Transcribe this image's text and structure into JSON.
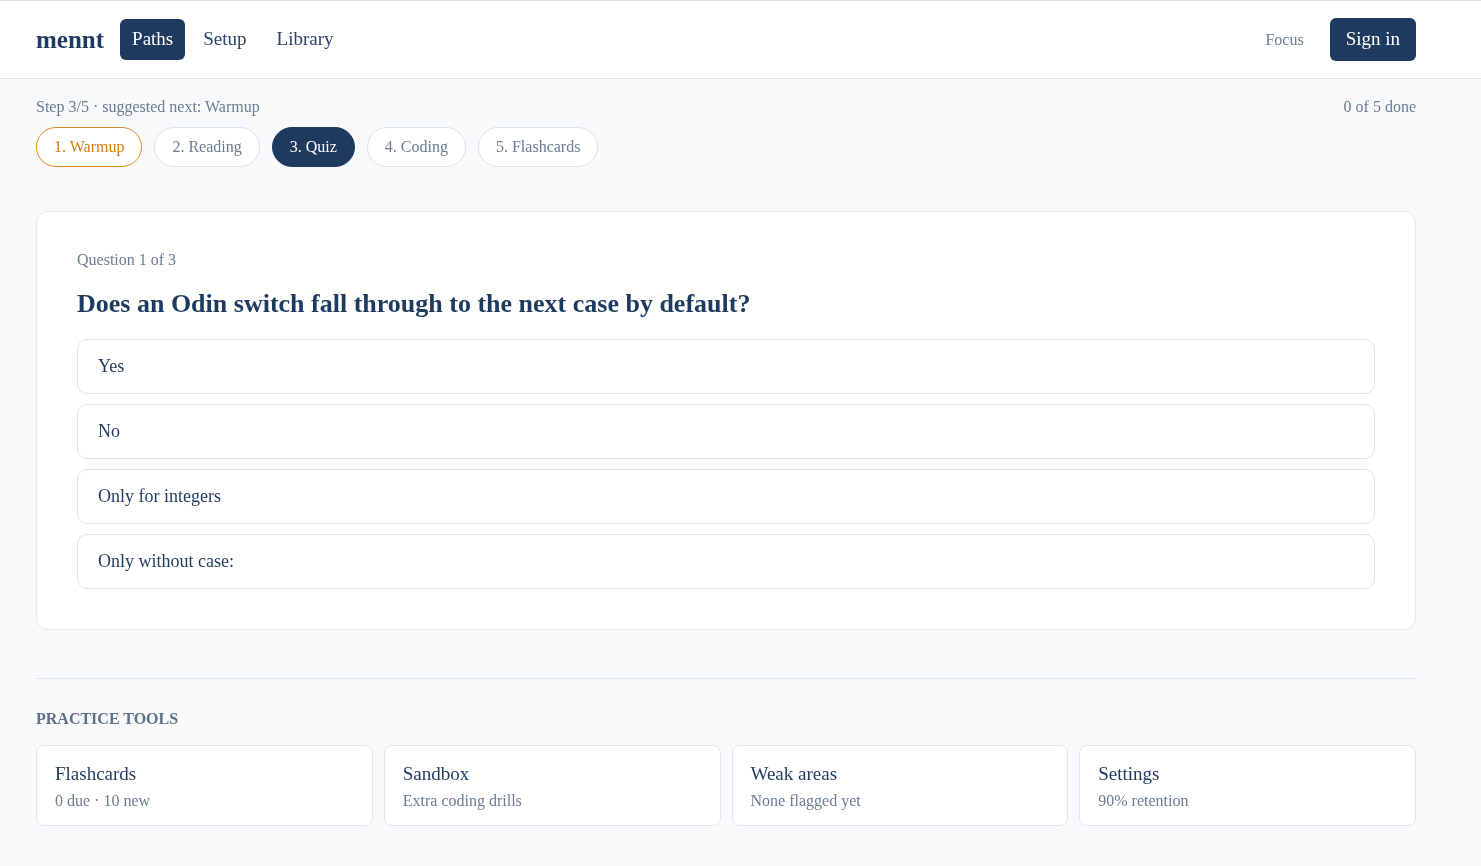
{
  "brand": "mennt",
  "nav": [
    {
      "label": "Paths",
      "selected": true
    },
    {
      "label": "Setup",
      "selected": false
    },
    {
      "label": "Library",
      "selected": false
    }
  ],
  "header_actions": {
    "focus": "Focus",
    "sign_in": "Sign in"
  },
  "progress": {
    "step_text": "Step 3/5 · suggested next: Warmup",
    "done_text": "0 of 5 done"
  },
  "steps": [
    {
      "label": "1. Warmup",
      "selected": false,
      "suggested": true
    },
    {
      "label": "2. Reading",
      "selected": false,
      "suggested": false
    },
    {
      "label": "3. Quiz",
      "selected": true,
      "suggested": false
    },
    {
      "label": "4. Coding",
      "selected": false,
      "suggested": false
    },
    {
      "label": "5. Flashcards",
      "selected": false,
      "suggested": false
    }
  ],
  "quiz": {
    "counter": "Question 1 of 3",
    "question": "Does an Odin switch fall through to the next case by default?",
    "options": [
      {
        "label": "Yes",
        "selected": false
      },
      {
        "label": "No",
        "selected": false
      },
      {
        "label": "Only for integers",
        "selected": false
      },
      {
        "label": "Only without case:",
        "selected": false
      }
    ]
  },
  "practice_tools": {
    "heading": "PRACTICE TOOLS",
    "items": [
      {
        "title": "Flashcards",
        "subtitle": "0 due · 10 new"
      },
      {
        "title": "Sandbox",
        "subtitle": "Extra coding drills"
      },
      {
        "title": "Weak areas",
        "subtitle": "None flagged yet"
      },
      {
        "title": "Settings",
        "subtitle": "90% retention"
      }
    ]
  }
}
